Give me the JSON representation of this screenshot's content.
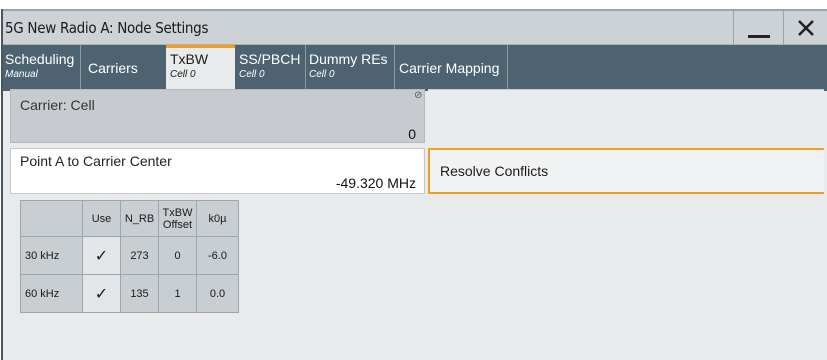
{
  "window": {
    "title": "5G New Radio A: Node Settings",
    "minimize_icon": "minimize-icon",
    "close_icon": "close-icon"
  },
  "tabs": [
    {
      "label": "Scheduling",
      "sub": "Manual",
      "active": false
    },
    {
      "label": "Carriers",
      "sub": "",
      "active": false
    },
    {
      "label": "TxBW",
      "sub": "Cell 0",
      "active": true
    },
    {
      "label": "SS/PBCH",
      "sub": "Cell 0",
      "active": false
    },
    {
      "label": "Dummy REs",
      "sub": "Cell 0",
      "active": false
    },
    {
      "label": "Carrier Mapping",
      "sub": "",
      "active": false
    }
  ],
  "carrier": {
    "label": "Carrier: Cell",
    "value": "0",
    "icon": "lock-icon"
  },
  "point_a": {
    "label": "Point A to Carrier Center",
    "value": "-49.320 MHz"
  },
  "resolve": {
    "label": "Resolve Conflicts"
  },
  "table": {
    "headers": [
      "",
      "Use",
      "N_RB",
      "TxBW Offset",
      "k0µ"
    ],
    "header_offset_line1": "TxBW",
    "header_offset_line2": "Offset",
    "rows": [
      {
        "scs": "30 kHz",
        "use": "✓",
        "n_rb": "273",
        "offset": "0",
        "k0": "-6.0"
      },
      {
        "scs": "60 kHz",
        "use": "✓",
        "n_rb": "135",
        "offset": "1",
        "k0": "0.0"
      }
    ]
  },
  "colors": {
    "accent": "#f0a020",
    "tabbar": "#4d6372",
    "panel": "#e8eaeb"
  }
}
